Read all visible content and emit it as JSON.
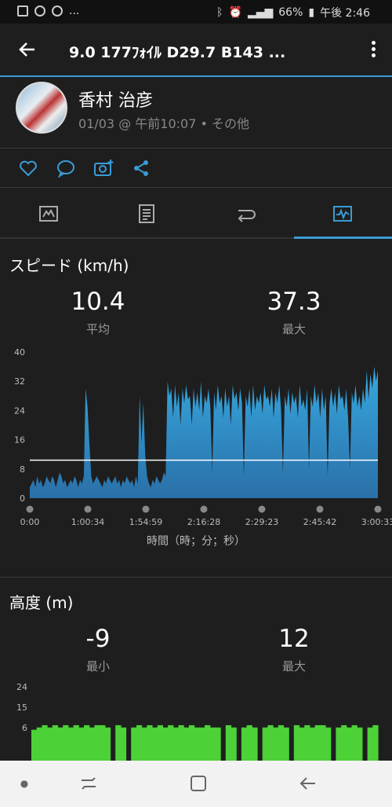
{
  "status_bar": {
    "battery": "66%",
    "time": "午後 2:46",
    "ellipsis": "..."
  },
  "header": {
    "title": "9.0  177ﾌｫｲﾙ   D29.7  B143 ..."
  },
  "profile": {
    "name": "香村 治彦",
    "meta": "01/03 @ 午前10:07 • その他"
  },
  "speed": {
    "title": "スピード (km/h)",
    "avg_value": "10.4",
    "avg_label": "平均",
    "max_value": "37.3",
    "max_label": "最大",
    "x_axis_label": "時間（時；分；秒）"
  },
  "elevation": {
    "title": "高度 (m)",
    "min_value": "-9",
    "min_label": "最小",
    "max_value": "12",
    "max_label": "最大"
  },
  "chart_data": [
    {
      "type": "area",
      "title": "スピード (km/h)",
      "xlabel": "時間（時；分；秒）",
      "ylabel": "",
      "y_ticks": [
        "0",
        "8",
        "16",
        "24",
        "32",
        "40"
      ],
      "ylim": [
        0,
        40
      ],
      "x_ticks": [
        "0:00",
        "1:00:34",
        "1:54:59",
        "2:16:28",
        "2:29:23",
        "2:45:42",
        "3:00:33"
      ],
      "average_line": 10.4,
      "color": "#2f8fc6",
      "values": [
        3,
        4,
        5,
        3,
        6,
        4,
        5,
        3,
        4,
        6,
        5,
        4,
        6,
        5,
        3,
        5,
        7,
        6,
        4,
        5,
        3,
        4,
        5,
        4,
        6,
        5,
        3,
        5,
        4,
        6,
        30,
        25,
        15,
        6,
        4,
        5,
        6,
        5,
        4,
        3,
        5,
        4,
        6,
        5,
        4,
        5,
        6,
        4,
        5,
        3,
        5,
        4,
        6,
        5,
        4,
        5,
        3,
        6,
        4,
        28,
        15,
        26,
        12,
        6,
        4,
        3,
        5,
        4,
        6,
        5,
        4,
        5,
        7,
        6,
        32,
        28,
        30,
        22,
        31,
        25,
        29,
        20,
        30,
        26,
        31,
        27,
        28,
        20,
        30,
        25,
        29,
        24,
        32,
        22,
        28,
        26,
        30,
        25,
        7,
        29,
        24,
        31,
        26,
        28,
        22,
        30,
        25,
        28,
        20,
        31,
        27,
        29,
        24,
        30,
        26,
        6,
        28,
        25,
        30,
        22,
        31,
        24,
        28,
        26,
        29,
        23,
        31,
        27,
        28,
        25,
        30,
        22,
        29,
        26,
        31,
        24,
        7,
        28,
        25,
        30,
        23,
        29,
        26,
        28,
        22,
        31,
        25,
        27,
        24,
        30,
        8,
        28,
        25,
        31,
        26,
        29,
        22,
        30,
        24,
        28,
        6,
        26,
        30,
        25,
        29,
        23,
        31,
        27,
        28,
        24,
        30,
        22,
        8,
        29,
        26,
        31,
        25,
        28,
        24,
        30,
        26,
        35,
        27,
        34,
        30,
        36,
        32,
        35
      ]
    },
    {
      "type": "area",
      "title": "高度 (m)",
      "y_ticks": [
        "6",
        "15",
        "24"
      ],
      "color": "#4cd137",
      "values": [
        5,
        6,
        7,
        6,
        7,
        6,
        7,
        6,
        7,
        6,
        7,
        6,
        7,
        7,
        6,
        0,
        7,
        6,
        0,
        6,
        7,
        6,
        7,
        6,
        7,
        6,
        7,
        6,
        7,
        6,
        7,
        6,
        6,
        7,
        6,
        6,
        0,
        7,
        6,
        0,
        6,
        7,
        6,
        0,
        6,
        7,
        6,
        7,
        6,
        0,
        7,
        6,
        7,
        6,
        7,
        7,
        6,
        0,
        6,
        7,
        6,
        7,
        6,
        0,
        6,
        7
      ]
    }
  ]
}
